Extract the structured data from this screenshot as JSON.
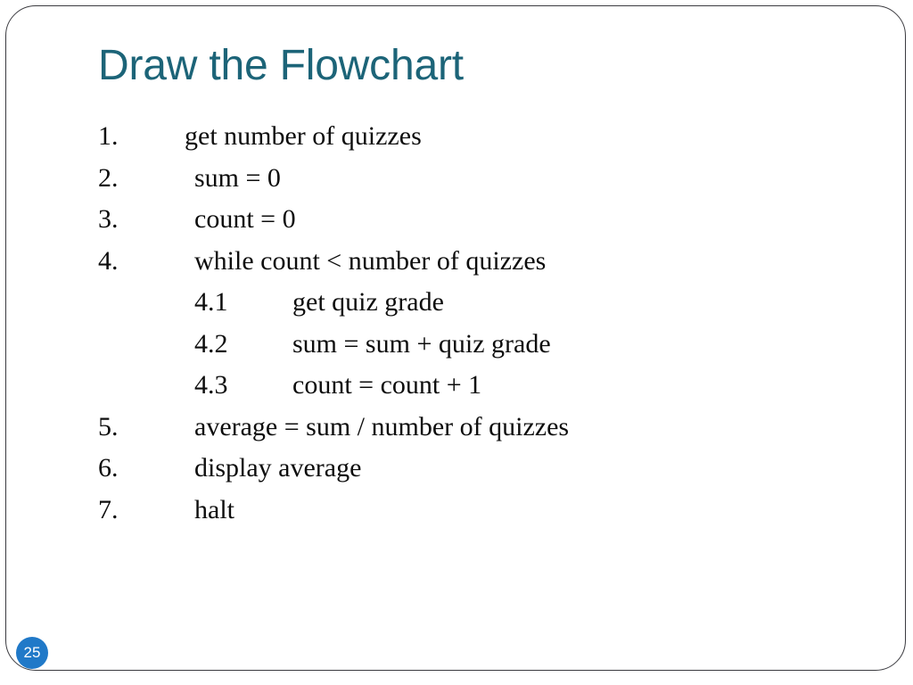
{
  "slide": {
    "title": "Draw the Flowchart",
    "title_color": "#1c6478",
    "background_color": "#ffffff",
    "border_color": "#3b3b40",
    "body_text_color": "#0d0d0d"
  },
  "algorithm": {
    "lines": [
      {
        "number": "1.",
        "text": "get number of quizzes",
        "level": 1
      },
      {
        "number": "2.",
        "text": "sum = 0",
        "level": 1
      },
      {
        "number": "3.",
        "text": "count = 0",
        "level": 1
      },
      {
        "number": "4.",
        "text": "while count < number of quizzes",
        "level": 1
      },
      {
        "number": "4.1",
        "text": "get quiz grade",
        "level": 2
      },
      {
        "number": "4.2",
        "text": "sum = sum + quiz grade",
        "level": 2
      },
      {
        "number": "4.3",
        "text": "count = count + 1",
        "level": 2
      },
      {
        "number": "5.",
        "text": "average = sum / number of quizzes",
        "level": 1
      },
      {
        "number": "6.",
        "text": "display average",
        "level": 1
      },
      {
        "number": "7.",
        "text": "halt",
        "level": 1
      }
    ]
  },
  "page_badge": {
    "number": "25",
    "background_color": "#2079c8",
    "text_color": "#ffffff"
  }
}
